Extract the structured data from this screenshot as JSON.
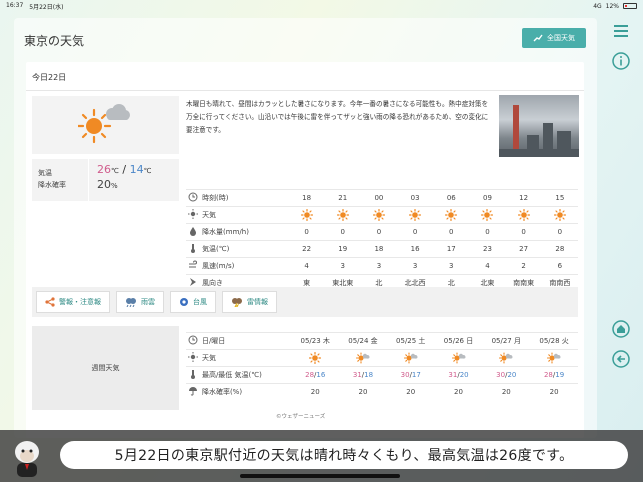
{
  "status_bar": {
    "time": "16:37",
    "date": "5月22日(水)",
    "signal": "4G",
    "battery": "12%"
  },
  "header": {
    "title": "東京の天気",
    "national_button": "全国天気"
  },
  "today": {
    "heading": "今日22日",
    "icon": "sunny-then-cloudy-icon",
    "temp_label": "気温",
    "rain_label": "降水確率",
    "high": "26",
    "low": "14",
    "temp_unit": "℃",
    "separator": "/",
    "rain_value": "20",
    "rain_unit": "%",
    "description": "木曜日も晴れて、昼間はカラッとした暑さになります。今年一番の暑さになる可能性も。熱中症対策を万全に行ってください。山沿いでは午後に雷を伴ってザッと強い雨の降る恐れがあるため、空の変化に要注意です。"
  },
  "hourly": {
    "labels": {
      "time": "時刻(時)",
      "weather": "天気",
      "precip": "降水量(mm/h)",
      "temp": "気温(℃)",
      "wind_speed": "風速(m/s)",
      "wind_dir": "風向き"
    },
    "times": [
      "18",
      "21",
      "00",
      "03",
      "06",
      "09",
      "12",
      "15"
    ],
    "precip": [
      "0",
      "0",
      "0",
      "0",
      "0",
      "0",
      "0",
      "0"
    ],
    "temp": [
      "22",
      "19",
      "18",
      "16",
      "17",
      "23",
      "27",
      "28"
    ],
    "wind_speed": [
      "4",
      "3",
      "3",
      "3",
      "3",
      "4",
      "2",
      "6"
    ],
    "wind_dir": [
      "東",
      "東北東",
      "北",
      "北北西",
      "北",
      "北東",
      "南南東",
      "南南西"
    ]
  },
  "warnings": [
    "警報・注意報",
    "雨雲",
    "台風",
    "雷情報"
  ],
  "weekly": {
    "title": "週間天気",
    "labels": {
      "date": "日/曜日",
      "weather": "天気",
      "temp": "最高/最低 気温(℃)",
      "rain": "降水確率(%)"
    },
    "days": [
      {
        "date": "05/23 木",
        "high": "28",
        "low": "16",
        "rain": "20",
        "icon": "sunny-icon"
      },
      {
        "date": "05/24 金",
        "high": "31",
        "low": "18",
        "rain": "20",
        "icon": "sunny-cloudy-icon"
      },
      {
        "date": "05/25 土",
        "high": "30",
        "low": "17",
        "rain": "20",
        "icon": "sunny-cloudy-icon"
      },
      {
        "date": "05/26 日",
        "high": "31",
        "low": "20",
        "rain": "20",
        "icon": "sunny-cloudy-icon"
      },
      {
        "date": "05/27 月",
        "high": "30",
        "low": "20",
        "rain": "20",
        "icon": "sunny-cloudy-icon"
      },
      {
        "date": "05/28 火",
        "high": "28",
        "low": "19",
        "rain": "20",
        "icon": "sunny-cloudy-icon"
      }
    ],
    "slash": "/"
  },
  "credit": "©ウェザーニューズ",
  "caption": "5月22日の東京駅付近の天気は晴れ時々くもり、最高気温は26度です。",
  "colors": {
    "accent": "#4aaeaa",
    "high": "#d05c8c",
    "low": "#4a86c8",
    "sun": "#f08a24"
  }
}
